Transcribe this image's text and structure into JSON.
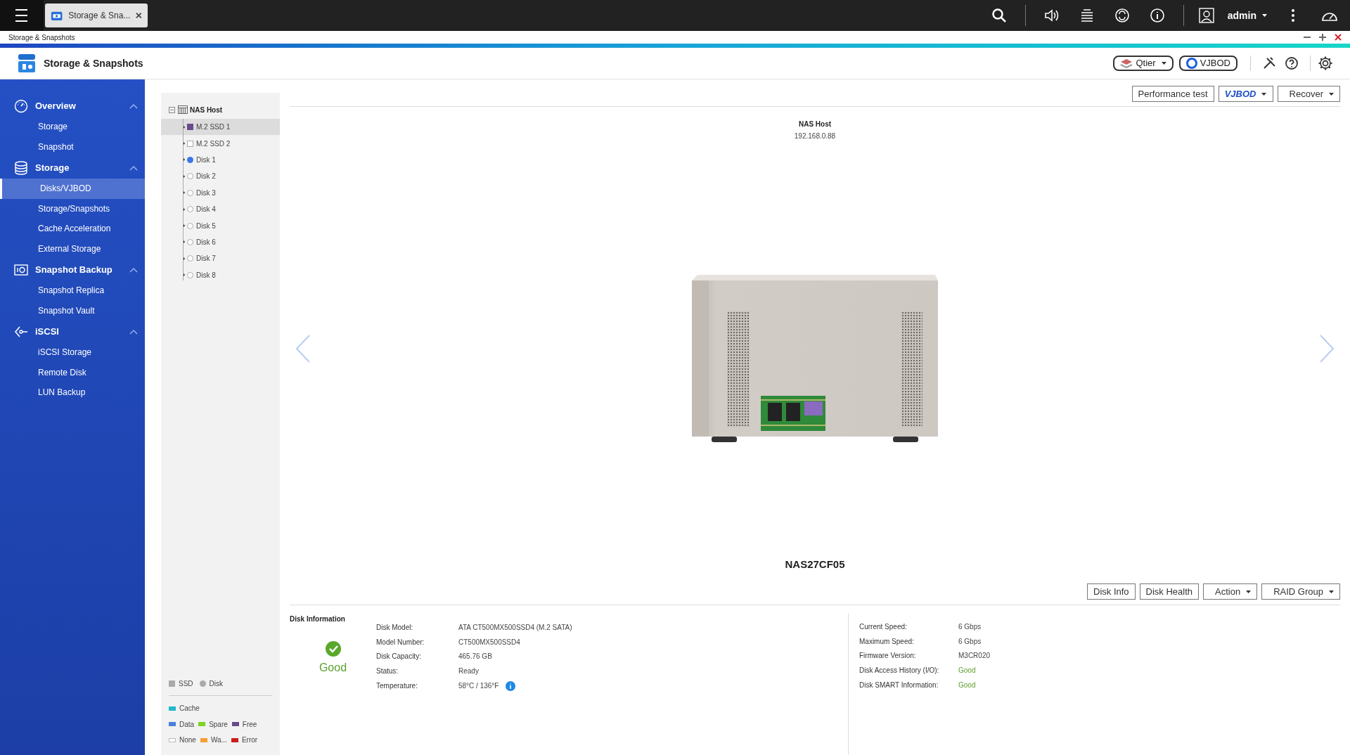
{
  "top_bar": {
    "app_tab": {
      "label": "Storage & Sna...",
      "selected": true
    },
    "user": "admin"
  },
  "window": {
    "title": "Storage & Snapshots"
  },
  "app_header": {
    "title": "Storage & Snapshots",
    "buttons": [
      {
        "label": "Qtier",
        "kind": "dropdown"
      },
      {
        "label": "VJBOD",
        "kind": "button"
      }
    ]
  },
  "sidebar": {
    "sections": [
      {
        "label": "Overview",
        "kind": "gauge",
        "expanded": true,
        "items": [
          {
            "label": "Storage",
            "selected": false
          },
          {
            "label": "Snapshot",
            "selected": false
          }
        ]
      },
      {
        "label": "Storage",
        "kind": "database",
        "expanded": true,
        "items": [
          {
            "label": "Disks/VJBOD",
            "selected": true
          },
          {
            "label": "Storage/Snapshots",
            "selected": false
          },
          {
            "label": "Cache Acceleration",
            "selected": false
          },
          {
            "label": "External Storage",
            "selected": false
          }
        ]
      },
      {
        "label": "Snapshot Backup",
        "kind": "camera",
        "expanded": true,
        "items": [
          {
            "label": "Snapshot Replica",
            "selected": false
          },
          {
            "label": "Snapshot Vault",
            "selected": false
          }
        ]
      },
      {
        "label": "iSCSI",
        "kind": "plug",
        "expanded": true,
        "items": [
          {
            "label": "iSCSI Storage",
            "selected": false
          },
          {
            "label": "Remote Disk",
            "selected": false
          },
          {
            "label": "LUN Backup",
            "selected": false
          }
        ]
      }
    ]
  },
  "tree": {
    "label": "NAS Host",
    "expanded": true,
    "children": [
      {
        "label": "M.2 SSD 1",
        "kind": "ssd",
        "color": "#6b4a8c",
        "selected": true
      },
      {
        "label": "M.2 SSD 2",
        "kind": "ssd",
        "selected": false
      },
      {
        "label": "Disk 1",
        "kind": "disk",
        "color": "#3b78e7",
        "selected": false
      },
      {
        "label": "Disk 2",
        "kind": "disk",
        "selected": false
      },
      {
        "label": "Disk 3",
        "kind": "disk",
        "selected": false
      },
      {
        "label": "Disk 4",
        "kind": "disk",
        "selected": false
      },
      {
        "label": "Disk 5",
        "kind": "disk",
        "selected": false
      },
      {
        "label": "Disk 6",
        "kind": "disk",
        "selected": false
      },
      {
        "label": "Disk 7",
        "kind": "disk",
        "selected": false
      },
      {
        "label": "Disk 8",
        "kind": "disk",
        "selected": false
      }
    ]
  },
  "legend": {
    "types": [
      {
        "label": "SSD",
        "kind": "ssd"
      },
      {
        "label": "Disk",
        "kind": "disk"
      }
    ],
    "roles": [
      [
        {
          "label": "Cache",
          "color": "#22b8c8"
        }
      ],
      [
        {
          "label": "Data",
          "color": "#4a7fe0"
        },
        {
          "label": "Spare",
          "color": "#7ed321"
        },
        {
          "label": "Free",
          "color": "#6b4a8c"
        }
      ],
      [
        {
          "label": "None",
          "color": "#ffffff"
        },
        {
          "label": "Wa...",
          "color": "#f5a030"
        },
        {
          "label": "Error",
          "color": "#c81e1e"
        }
      ]
    ]
  },
  "toolbar": [
    {
      "label": "Performance test",
      "kind": "button"
    },
    {
      "label": "VJBOD",
      "kind": "logo-dropdown"
    },
    {
      "label": "Recover",
      "kind": "dropdown"
    }
  ],
  "enclosure": {
    "title": "NAS Host",
    "address": "192.168.0.88",
    "name": "NAS27CF05"
  },
  "disk_buttons": [
    {
      "label": "Disk Info",
      "kind": "button"
    },
    {
      "label": "Disk Health",
      "kind": "button"
    },
    {
      "label": "Action",
      "kind": "dropdown"
    },
    {
      "label": "RAID Group",
      "kind": "dropdown"
    }
  ],
  "disk_information": {
    "title": "Disk Information",
    "health": "Good",
    "left": [
      {
        "label": "Disk Model:",
        "value": "ATA CT500MX500SSD4 (M.2 SATA)"
      },
      {
        "label": "Model Number:",
        "value": "CT500MX500SSD4"
      },
      {
        "label": "Disk Capacity:",
        "value": "465.76 GB"
      },
      {
        "label": "Status:",
        "value": "Ready"
      },
      {
        "label": "Temperature:",
        "value": "58°C / 136°F",
        "info": true
      }
    ],
    "right": [
      {
        "label": "Current Speed:",
        "value": "6 Gbps"
      },
      {
        "label": "Maximum Speed:",
        "value": "6 Gbps"
      },
      {
        "label": "Firmware Version:",
        "value": "M3CR020"
      },
      {
        "label": "Disk Access History (I/O):",
        "value": "Good",
        "color": "#5a9e2a"
      },
      {
        "label": "Disk SMART Information:",
        "value": "Good",
        "color": "#5a9e2a"
      }
    ]
  }
}
